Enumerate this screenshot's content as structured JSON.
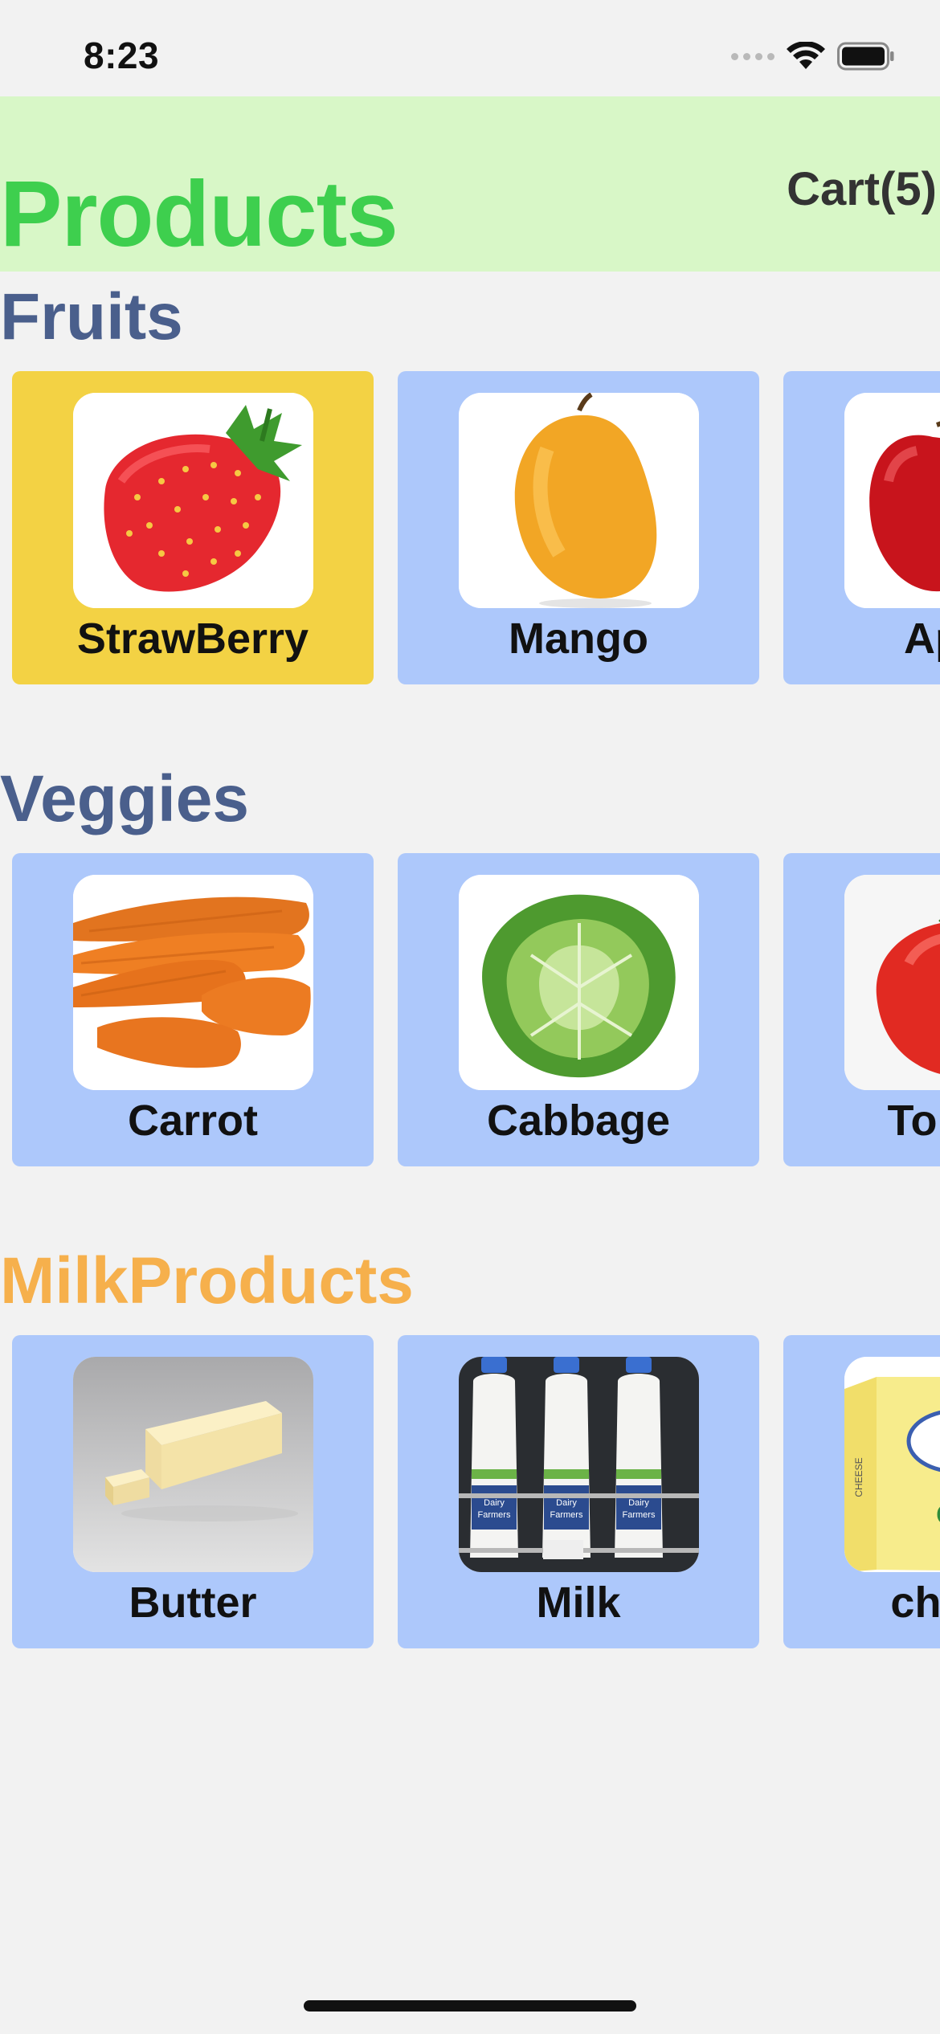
{
  "status_bar": {
    "time": "8:23"
  },
  "header": {
    "title": "Products",
    "cart_label": "Cart(5)",
    "background": "#d8f7c7",
    "title_color": "#3ecf4e"
  },
  "sections": [
    {
      "title": "Fruits",
      "title_color": "#4a5f8c",
      "items": [
        {
          "label": "StrawBerry",
          "icon": "strawberry-image",
          "selected": true
        },
        {
          "label": "Mango",
          "icon": "mango-image",
          "selected": false
        },
        {
          "label": "Apple",
          "icon": "apple-image",
          "selected": false
        }
      ]
    },
    {
      "title": "Veggies",
      "title_color": "#4a5f8c",
      "items": [
        {
          "label": "Carrot",
          "icon": "carrot-image",
          "selected": false
        },
        {
          "label": "Cabbage",
          "icon": "cabbage-image",
          "selected": false
        },
        {
          "label": "Tomato",
          "icon": "tomato-image",
          "selected": false
        }
      ]
    },
    {
      "title": "MilkProducts",
      "title_color": "#f6b04c",
      "items": [
        {
          "label": "Butter",
          "icon": "butter-image",
          "selected": false
        },
        {
          "label": "Milk",
          "icon": "milk-image",
          "selected": false
        },
        {
          "label": "cheese",
          "icon": "cheese-image",
          "selected": false
        }
      ]
    }
  ],
  "colors": {
    "card_default": "#adc8fb",
    "card_selected": "#f3d244",
    "background": "#f2f2f2"
  }
}
